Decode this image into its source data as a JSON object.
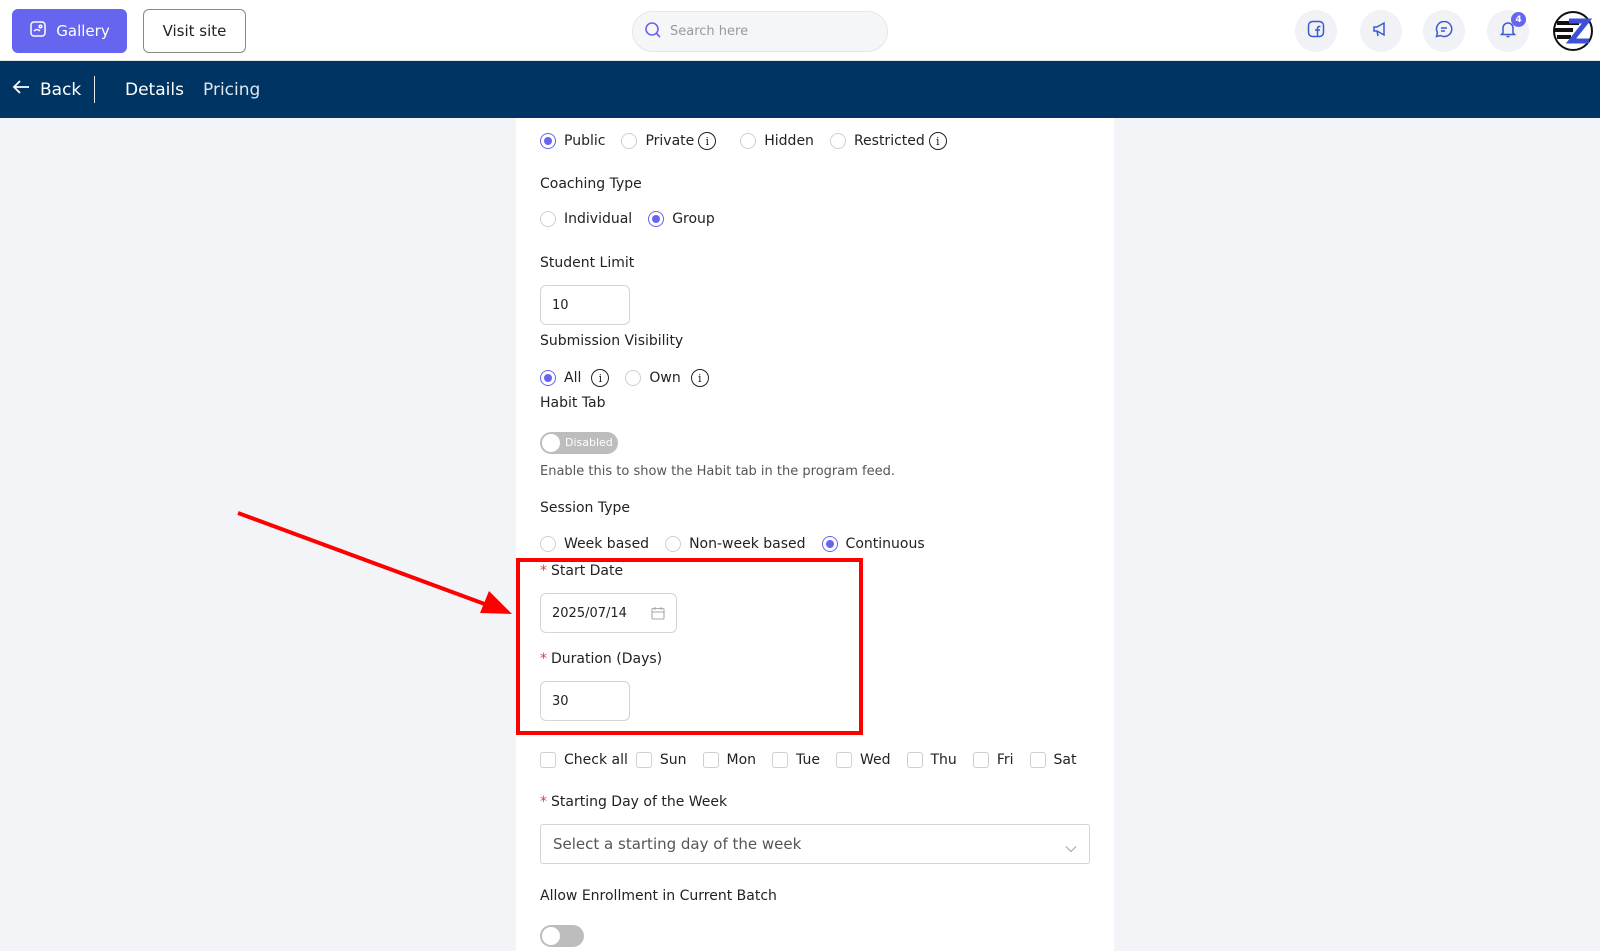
{
  "topbar": {
    "gallery_label": "Gallery",
    "visit_site_label": "Visit site",
    "search_placeholder": "Search here",
    "notification_count": "4"
  },
  "nav": {
    "back_label": "Back",
    "tabs": [
      "Details",
      "Pricing"
    ]
  },
  "form": {
    "visibility": {
      "options": [
        "Public",
        "Private",
        "Hidden",
        "Restricted"
      ],
      "selected": "Public"
    },
    "coaching_type": {
      "label": "Coaching Type",
      "options": [
        "Individual",
        "Group"
      ],
      "selected": "Group"
    },
    "student_limit": {
      "label": "Student Limit",
      "value": "10"
    },
    "submission_visibility": {
      "label": "Submission Visibility",
      "options": [
        "All",
        "Own"
      ],
      "selected": "All"
    },
    "habit_tab": {
      "label": "Habit Tab",
      "toggle_text": "Disabled",
      "enabled": false,
      "hint": "Enable this to show the Habit tab in the program feed."
    },
    "session_type": {
      "label": "Session Type",
      "options": [
        "Week based",
        "Non-week based",
        "Continuous"
      ],
      "selected": "Continuous"
    },
    "start_date": {
      "required_mark": "*",
      "label": "Start Date",
      "value": "2025/07/14"
    },
    "duration": {
      "required_mark": "*",
      "label": "Duration (Days)",
      "value": "30"
    },
    "days": {
      "check_all_label": "Check all",
      "items": [
        "Sun",
        "Mon",
        "Tue",
        "Wed",
        "Thu",
        "Fri",
        "Sat"
      ]
    },
    "starting_day": {
      "required_mark": "*",
      "label": "Starting Day of the Week",
      "placeholder": "Select a starting day of the week"
    },
    "allow_enrollment": {
      "label": "Allow Enrollment in Current Batch",
      "enabled": false
    }
  },
  "colors": {
    "accent": "#6565f0",
    "navbar": "#003463",
    "annotation": "#ff0000",
    "required": "#e63a3a"
  }
}
